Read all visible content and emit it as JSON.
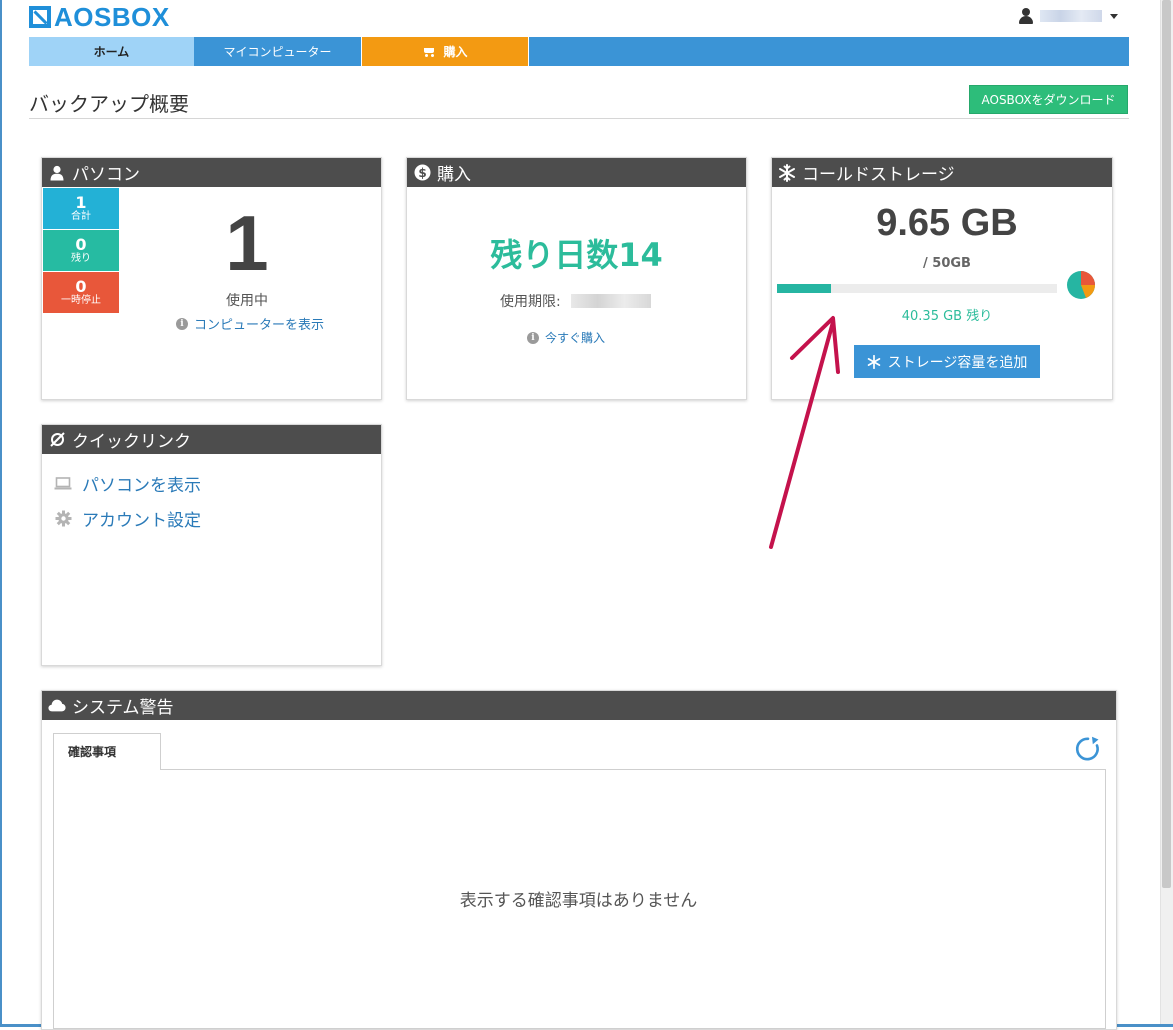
{
  "brand": {
    "name": "AOSBOX"
  },
  "nav": {
    "home": "ホーム",
    "my_computer": "マイコンピューター",
    "purchase": "購入"
  },
  "page": {
    "title": "バックアップ概要",
    "download_button": "AOSBOXをダウンロード"
  },
  "pc_panel": {
    "title": "パソコン",
    "tiles": [
      {
        "num": "1",
        "label": "合計"
      },
      {
        "num": "0",
        "label": "残り"
      },
      {
        "num": "0",
        "label": "一時停止"
      }
    ],
    "big_number": "1",
    "in_use_label": "使用中",
    "show_computers_link": "コンピューターを表示"
  },
  "purchase_panel": {
    "title": "購入",
    "remaining_days": "残り日数14",
    "expiry_label": "使用期限:",
    "buy_now_link": "今すぐ購入"
  },
  "storage_panel": {
    "title": "コールドストレージ",
    "used": "9.65 GB",
    "total": "/ 50GB",
    "used_fraction": 0.193,
    "remaining": "40.35 GB 残り",
    "add_button": "ストレージ容量を追加",
    "colors": {
      "bar": "#26b5a2",
      "pie_main": "#26b5a2",
      "pie_a": "#e8573a",
      "pie_b": "#f39a12"
    }
  },
  "quicklinks_panel": {
    "title": "クイックリンク",
    "items": [
      {
        "label": "パソコンを表示",
        "icon": "laptop-icon"
      },
      {
        "label": "アカウント設定",
        "icon": "gear-icon"
      }
    ]
  },
  "warnings_panel": {
    "title": "システム警告",
    "tab_label": "確認事項",
    "empty_message": "表示する確認事項はありません"
  }
}
